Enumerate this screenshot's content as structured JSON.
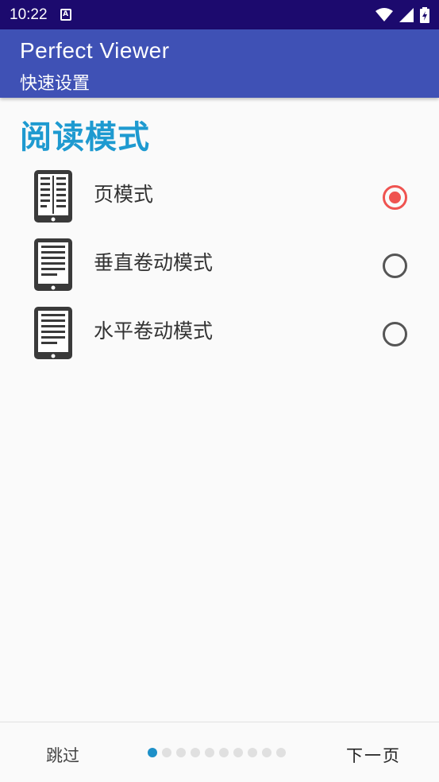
{
  "status_bar": {
    "time": "10:22",
    "notification_icon": "a-box-icon",
    "icons": [
      "wifi-icon",
      "signal-icon",
      "battery-charging-icon"
    ]
  },
  "app_bar": {
    "title": "Perfect Viewer",
    "subtitle": "快速设置"
  },
  "section": {
    "title": "阅读模式",
    "modes": [
      {
        "label": "页模式",
        "icon": "page-mode-icon",
        "selected": true
      },
      {
        "label": "垂直卷动模式",
        "icon": "vertical-scroll-icon",
        "selected": false
      },
      {
        "label": "水平卷动模式",
        "icon": "horizontal-scroll-icon",
        "selected": false
      }
    ]
  },
  "bottom_bar": {
    "skip_label": "跳过",
    "next_label": "下一页",
    "pages_total": 10,
    "current_page": 1
  },
  "colors": {
    "status_bar": "#1c0a6e",
    "app_bar": "#3f51b5",
    "section_title": "#1e9ad0",
    "radio_selected": "#ef5350",
    "dot_active": "#1e90c8"
  }
}
